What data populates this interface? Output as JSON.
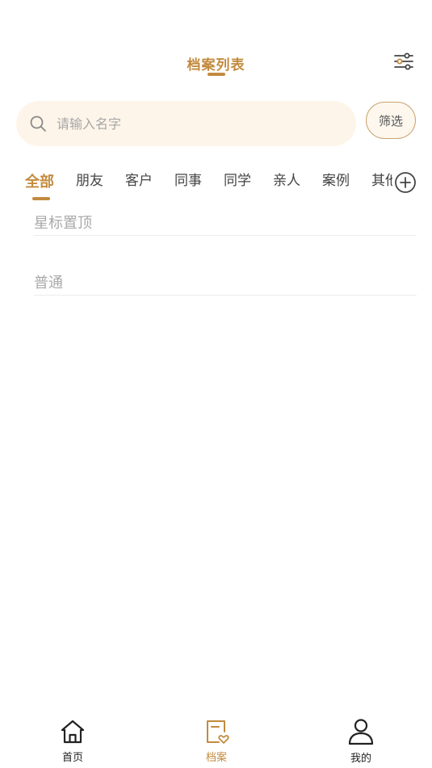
{
  "header": {
    "title": "档案列表",
    "settings_icon": "sliders-icon"
  },
  "search": {
    "placeholder": "请输入名字",
    "value": "",
    "icon": "search-icon"
  },
  "filter_button": {
    "label": "筛选"
  },
  "tabs": [
    {
      "label": "全部",
      "active": true
    },
    {
      "label": "朋友",
      "active": false
    },
    {
      "label": "客户",
      "active": false
    },
    {
      "label": "同事",
      "active": false
    },
    {
      "label": "同学",
      "active": false
    },
    {
      "label": "亲人",
      "active": false
    },
    {
      "label": "案例",
      "active": false
    },
    {
      "label": "其他",
      "active": false
    }
  ],
  "add_tab_icon": "plus-circle-icon",
  "sections": [
    {
      "label": "星标置顶"
    },
    {
      "label": "普通"
    }
  ],
  "bottom_nav": [
    {
      "label": "首页",
      "icon": "home-icon",
      "active": false
    },
    {
      "label": "档案",
      "icon": "archive-heart-icon",
      "active": true
    },
    {
      "label": "我的",
      "icon": "user-icon",
      "active": false
    }
  ],
  "colors": {
    "accent": "#c38a3e",
    "search_bg": "#fdf5e9",
    "text": "#444444",
    "muted": "#a9a9a9"
  }
}
